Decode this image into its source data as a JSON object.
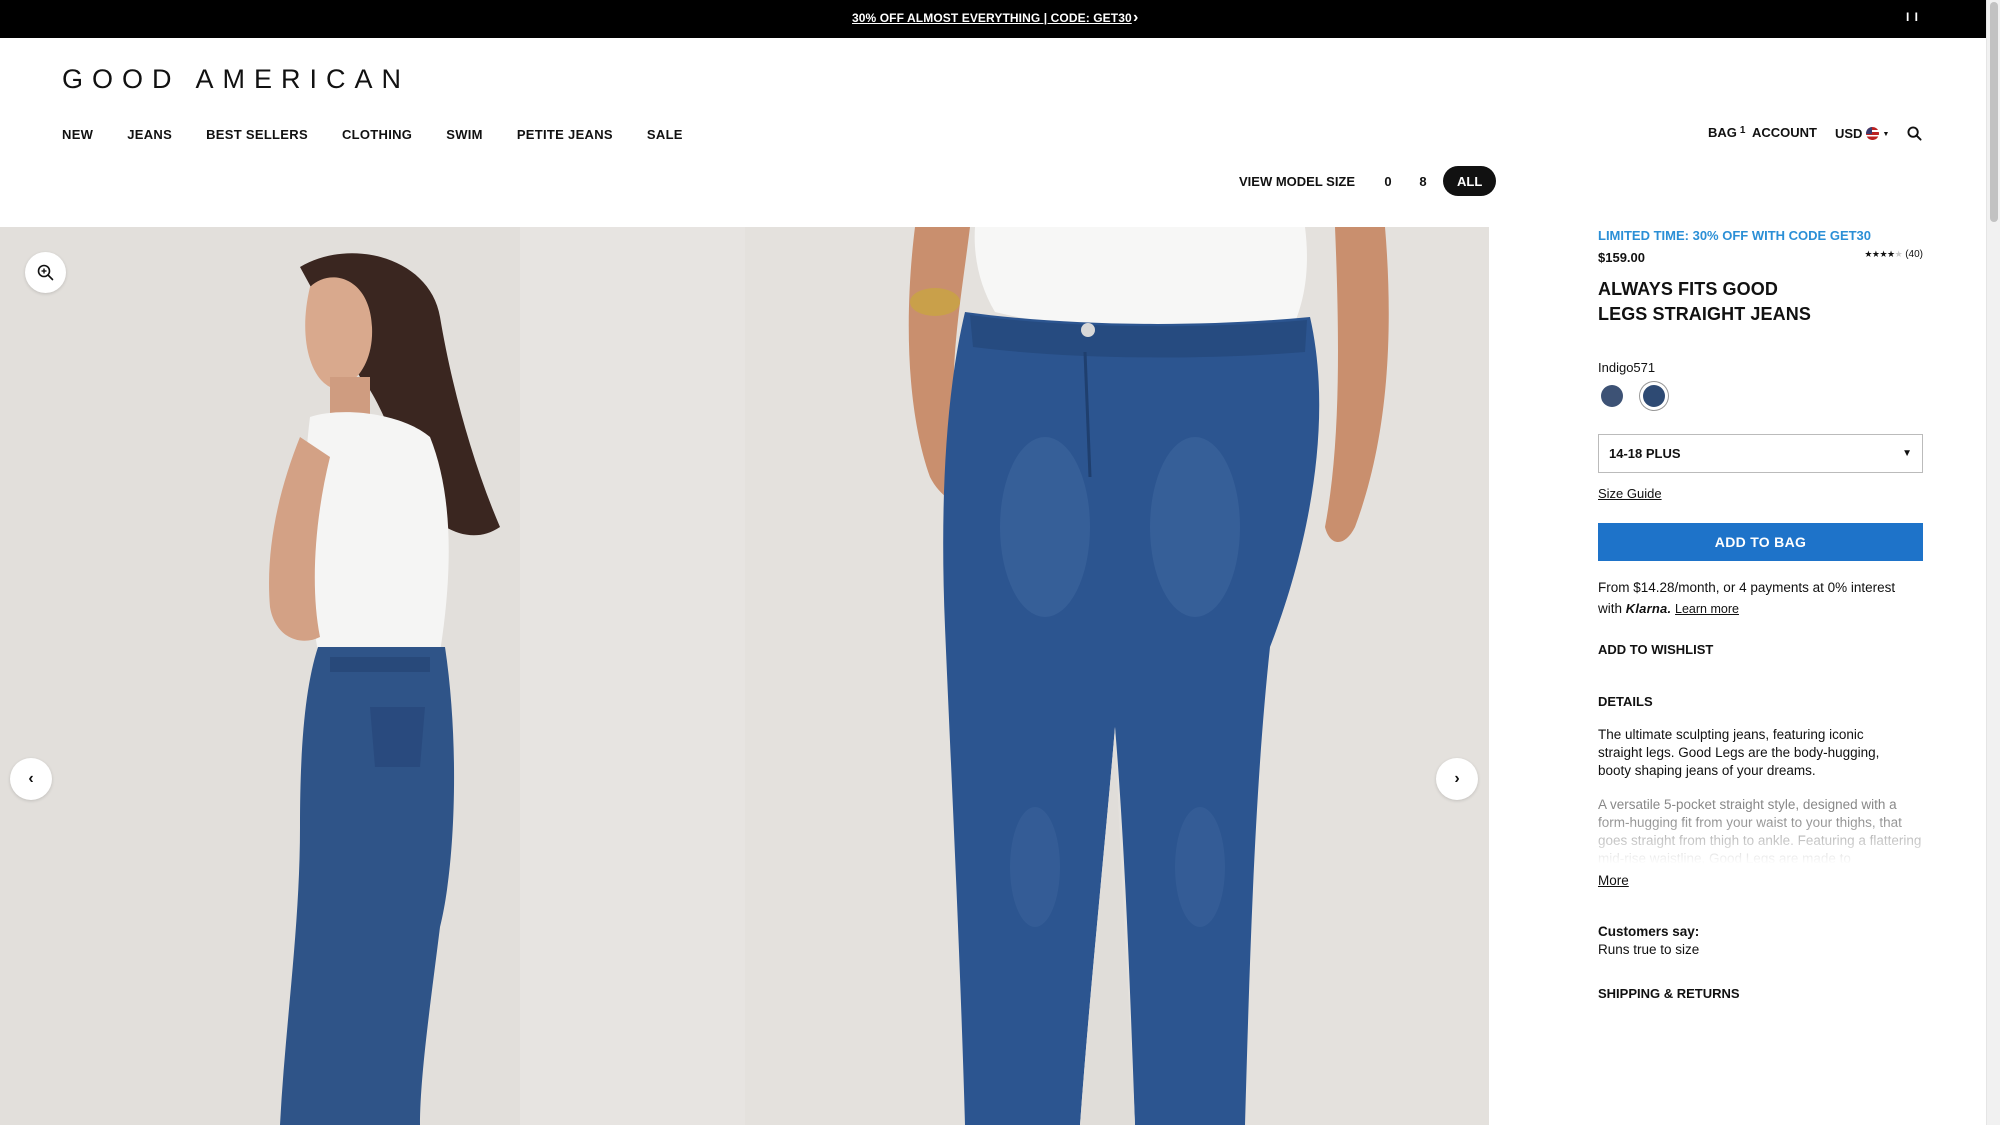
{
  "announcement": {
    "text": "30% OFF ALMOST EVERYTHING | CODE: GET30",
    "chevron": "›",
    "pause": "I I"
  },
  "brand": {
    "logo": "GOOD AMERICAN"
  },
  "nav": {
    "items": [
      {
        "label": "NEW"
      },
      {
        "label": "JEANS"
      },
      {
        "label": "BEST SELLERS"
      },
      {
        "label": "CLOTHING"
      },
      {
        "label": "SWIM"
      },
      {
        "label": "PETITE JEANS"
      },
      {
        "label": "SALE"
      }
    ],
    "bag_label": "BAG",
    "bag_count": "1",
    "account_label": "ACCOUNT",
    "currency": "USD",
    "currency_caret": "▼"
  },
  "model_size": {
    "label": "VIEW MODEL SIZE",
    "options": [
      "0",
      "8",
      "ALL"
    ],
    "selected": "ALL"
  },
  "gallery": {
    "prev": "‹",
    "next": "›"
  },
  "product": {
    "promo": "LIMITED TIME: 30% OFF WITH CODE GET30",
    "price": "$159.00",
    "rating_value": 4,
    "rating_max": 5,
    "review_count": "(40)",
    "title_line1": "ALWAYS FITS GOOD",
    "title_line2": "LEGS STRAIGHT JEANS",
    "color_name": "Indigo571",
    "swatches": [
      {
        "color": "#3d5275",
        "selected": false
      },
      {
        "color": "#2e4a73",
        "selected": true
      }
    ],
    "size_selected": "14-18 PLUS",
    "size_caret": "▼",
    "size_guide": "Size Guide",
    "add_to_bag": "ADD TO BAG",
    "klarna_text_1": "From $14.28/month, or 4 payments at 0% interest",
    "klarna_text_2": "with",
    "klarna_logo": "Klarna.",
    "learn_more": "Learn more",
    "wishlist": "ADD TO WISHLIST",
    "details_heading": "DETAILS",
    "details_p1": "The ultimate sculpting jeans, featuring iconic straight legs. Good Legs are the body-hugging, booty shaping jeans of your dreams.",
    "details_p2": "A versatile 5-pocket straight style, designed with a form-hugging fit from your waist to your thighs, that goes straight from thigh to ankle. Featuring a flattering mid-rise waistline, Good Legs are made to",
    "more": "More",
    "customers_say_label": "Customers say:",
    "customers_say_value": "Runs true to size",
    "shipping": "SHIPPING & RETURNS"
  },
  "colors": {
    "accent_blue": "#1e73c9",
    "promo_blue": "#2b8fd6",
    "denim": "#2e4a73"
  }
}
